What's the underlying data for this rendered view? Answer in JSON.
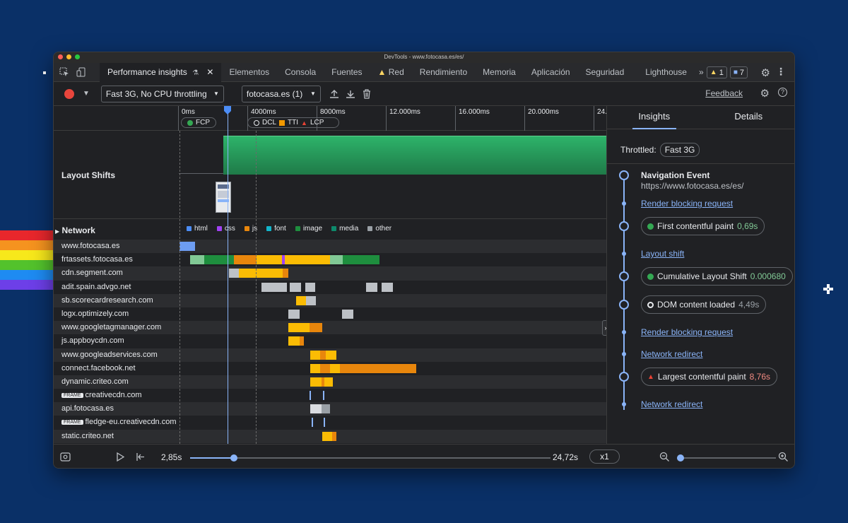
{
  "window": {
    "title": "DevTools - www.fotocasa.es/es/"
  },
  "tabs": [
    {
      "label": "Performance insights",
      "active": true
    },
    {
      "label": "Elementos"
    },
    {
      "label": "Consola"
    },
    {
      "label": "Fuentes"
    },
    {
      "label": "Red",
      "warning": true
    },
    {
      "label": "Rendimiento"
    },
    {
      "label": "Memoria"
    },
    {
      "label": "Aplicación"
    },
    {
      "label": "Seguridad"
    },
    {
      "label": "Lighthouse"
    }
  ],
  "badges": {
    "warnings": "1",
    "messages": "7"
  },
  "toolbar": {
    "throttle_value": "Fast 3G, No CPU throttling",
    "recording_value": "fotocasa.es (1)",
    "feedback_label": "Feedback"
  },
  "ruler": {
    "ticks": [
      "0ms",
      "4000ms",
      "8000ms",
      "12.000ms",
      "16.000ms",
      "20.000ms",
      "24."
    ],
    "markers": {
      "fcp": "FCP",
      "dcl": "DCL",
      "tti": "TTI",
      "lcp": "LCP"
    }
  },
  "layout_shifts": {
    "label": "Layout Shifts"
  },
  "network": {
    "label": "Network",
    "legend": [
      {
        "name": "html",
        "color": "#4c8df6"
      },
      {
        "name": "css",
        "color": "#a142f4"
      },
      {
        "name": "js",
        "color": "#e8860c"
      },
      {
        "name": "font",
        "color": "#12b5cb"
      },
      {
        "name": "image",
        "color": "#1e8e3e"
      },
      {
        "name": "media",
        "color": "#0d8a6b"
      },
      {
        "name": "other",
        "color": "#9aa0a6"
      }
    ],
    "rows": [
      {
        "host": "www.fotocasa.es",
        "frame": false
      },
      {
        "host": "frtassets.fotocasa.es",
        "frame": false
      },
      {
        "host": "cdn.segment.com",
        "frame": false
      },
      {
        "host": "adit.spain.advgo.net",
        "frame": false
      },
      {
        "host": "sb.scorecardresearch.com",
        "frame": false
      },
      {
        "host": "logx.optimizely.com",
        "frame": false
      },
      {
        "host": "www.googletagmanager.com",
        "frame": false
      },
      {
        "host": "js.appboycdn.com",
        "frame": false
      },
      {
        "host": "www.googleadservices.com",
        "frame": false
      },
      {
        "host": "connect.facebook.net",
        "frame": false
      },
      {
        "host": "dynamic.criteo.com",
        "frame": false
      },
      {
        "host": "creativecdn.com",
        "frame": true
      },
      {
        "host": "api.fotocasa.es",
        "frame": false
      },
      {
        "host": "fledge-eu.creativecdn.com",
        "frame": true
      },
      {
        "host": "static.criteo.net",
        "frame": false
      }
    ],
    "frame_badge": "FRAME"
  },
  "sidebar": {
    "tabs": {
      "insights": "Insights",
      "details": "Details"
    },
    "throttled_label": "Throttled:",
    "throttled_value": "Fast 3G",
    "nav_title": "Navigation Event",
    "nav_url": "https://www.fotocasa.es/es/",
    "link1": "Render blocking request",
    "fcp_label": "First contentful paint",
    "fcp_value": "0,69s",
    "link2": "Layout shift",
    "cls_label": "Cumulative Layout Shift",
    "cls_value": "0.000680",
    "dcl_label": "DOM content loaded",
    "dcl_value": "4,49s",
    "link3": "Render blocking request",
    "link4": "Network redirect",
    "lcp_label": "Largest contentful paint",
    "lcp_value": "8,76s",
    "link5": "Network redirect"
  },
  "playback": {
    "current": "2,85s",
    "total": "24,72s",
    "speed": "x1"
  }
}
